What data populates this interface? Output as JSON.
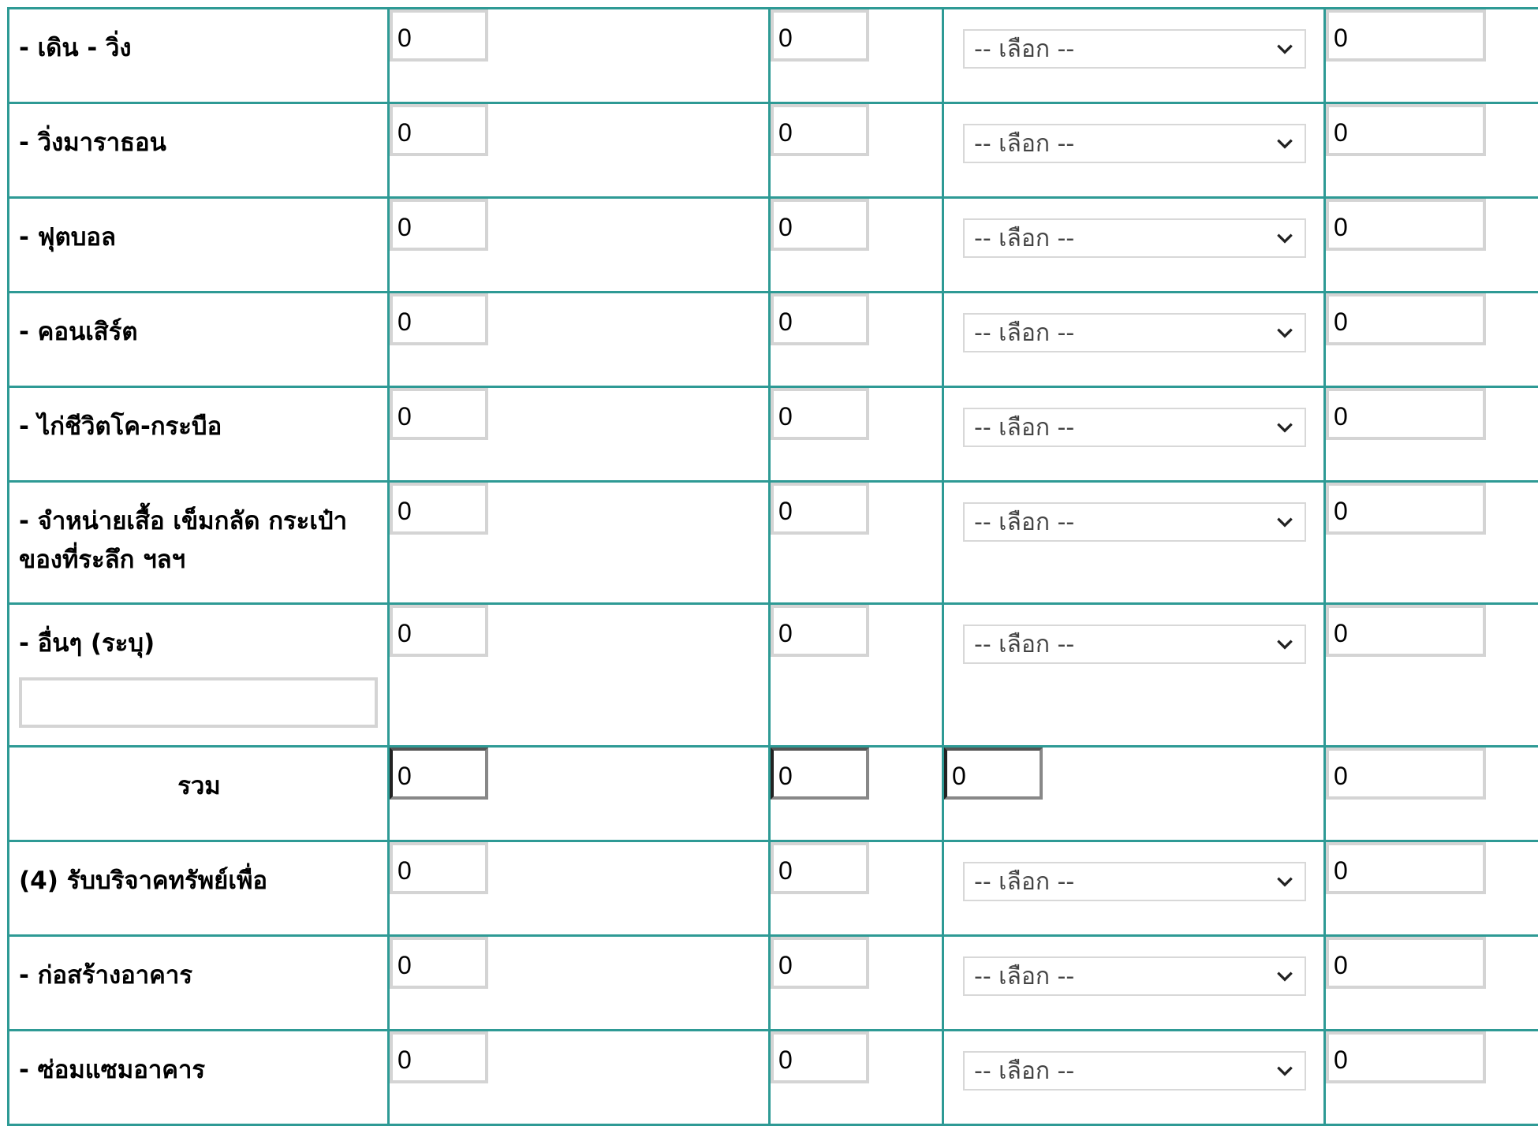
{
  "select_placeholder": "-- เลือก --",
  "rows": [
    {
      "label": "- เดิน - วิ่ง",
      "v1": "0",
      "v2": "0",
      "v4": "0"
    },
    {
      "label": "- วิ่งมาราธอน",
      "v1": "0",
      "v2": "0",
      "v4": "0"
    },
    {
      "label": "- ฟุตบอล",
      "v1": "0",
      "v2": "0",
      "v4": "0"
    },
    {
      "label": "- คอนเสิร์ต",
      "v1": "0",
      "v2": "0",
      "v4": "0"
    },
    {
      "label": "- ไก่ชีวิตโค-กระบือ",
      "v1": "0",
      "v2": "0",
      "v4": "0"
    },
    {
      "label": "- จำหน่ายเสื้อ เข็มกลัด กระเป๋า ของที่ระลึก ฯลฯ",
      "v1": "0",
      "v2": "0",
      "v4": "0"
    },
    {
      "label": "- อื่นๆ (ระบุ)",
      "v1": "0",
      "v2": "0",
      "v4": "0",
      "other_value": ""
    }
  ],
  "total": {
    "label": "รวม",
    "v1": "0",
    "v2": "0",
    "v3": "0",
    "v4": "0"
  },
  "rows2": [
    {
      "label": "(4) รับบริจาคทรัพย์เพื่อ",
      "v1": "0",
      "v2": "0",
      "v4": "0"
    },
    {
      "label": "- ก่อสร้างอาคาร",
      "v1": "0",
      "v2": "0",
      "v4": "0"
    },
    {
      "label": "- ซ่อมแซมอาคาร",
      "v1": "0",
      "v2": "0",
      "v4": "0"
    }
  ]
}
